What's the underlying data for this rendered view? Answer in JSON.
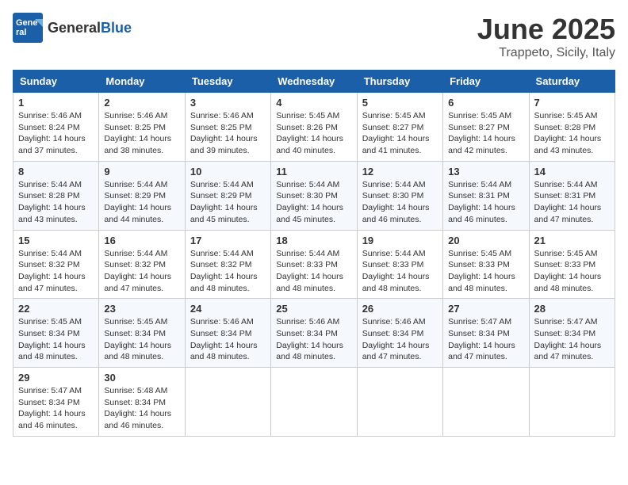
{
  "header": {
    "logo_general": "General",
    "logo_blue": "Blue",
    "month_title": "June 2025",
    "location": "Trappeto, Sicily, Italy"
  },
  "calendar": {
    "days_of_week": [
      "Sunday",
      "Monday",
      "Tuesday",
      "Wednesday",
      "Thursday",
      "Friday",
      "Saturday"
    ],
    "weeks": [
      [
        {
          "day": "",
          "content": ""
        },
        {
          "day": "2",
          "content": "Sunrise: 5:46 AM\nSunset: 8:25 PM\nDaylight: 14 hours\nand 38 minutes."
        },
        {
          "day": "3",
          "content": "Sunrise: 5:46 AM\nSunset: 8:25 PM\nDaylight: 14 hours\nand 39 minutes."
        },
        {
          "day": "4",
          "content": "Sunrise: 5:45 AM\nSunset: 8:26 PM\nDaylight: 14 hours\nand 40 minutes."
        },
        {
          "day": "5",
          "content": "Sunrise: 5:45 AM\nSunset: 8:27 PM\nDaylight: 14 hours\nand 41 minutes."
        },
        {
          "day": "6",
          "content": "Sunrise: 5:45 AM\nSunset: 8:27 PM\nDaylight: 14 hours\nand 42 minutes."
        },
        {
          "day": "7",
          "content": "Sunrise: 5:45 AM\nSunset: 8:28 PM\nDaylight: 14 hours\nand 43 minutes."
        }
      ],
      [
        {
          "day": "1",
          "content": "Sunrise: 5:46 AM\nSunset: 8:24 PM\nDaylight: 14 hours\nand 37 minutes."
        },
        {
          "day": "9",
          "content": "Sunrise: 5:44 AM\nSunset: 8:29 PM\nDaylight: 14 hours\nand 44 minutes."
        },
        {
          "day": "10",
          "content": "Sunrise: 5:44 AM\nSunset: 8:29 PM\nDaylight: 14 hours\nand 45 minutes."
        },
        {
          "day": "11",
          "content": "Sunrise: 5:44 AM\nSunset: 8:30 PM\nDaylight: 14 hours\nand 45 minutes."
        },
        {
          "day": "12",
          "content": "Sunrise: 5:44 AM\nSunset: 8:30 PM\nDaylight: 14 hours\nand 46 minutes."
        },
        {
          "day": "13",
          "content": "Sunrise: 5:44 AM\nSunset: 8:31 PM\nDaylight: 14 hours\nand 46 minutes."
        },
        {
          "day": "14",
          "content": "Sunrise: 5:44 AM\nSunset: 8:31 PM\nDaylight: 14 hours\nand 47 minutes."
        }
      ],
      [
        {
          "day": "8",
          "content": "Sunrise: 5:44 AM\nSunset: 8:28 PM\nDaylight: 14 hours\nand 43 minutes."
        },
        {
          "day": "16",
          "content": "Sunrise: 5:44 AM\nSunset: 8:32 PM\nDaylight: 14 hours\nand 47 minutes."
        },
        {
          "day": "17",
          "content": "Sunrise: 5:44 AM\nSunset: 8:32 PM\nDaylight: 14 hours\nand 48 minutes."
        },
        {
          "day": "18",
          "content": "Sunrise: 5:44 AM\nSunset: 8:33 PM\nDaylight: 14 hours\nand 48 minutes."
        },
        {
          "day": "19",
          "content": "Sunrise: 5:44 AM\nSunset: 8:33 PM\nDaylight: 14 hours\nand 48 minutes."
        },
        {
          "day": "20",
          "content": "Sunrise: 5:45 AM\nSunset: 8:33 PM\nDaylight: 14 hours\nand 48 minutes."
        },
        {
          "day": "21",
          "content": "Sunrise: 5:45 AM\nSunset: 8:33 PM\nDaylight: 14 hours\nand 48 minutes."
        }
      ],
      [
        {
          "day": "15",
          "content": "Sunrise: 5:44 AM\nSunset: 8:32 PM\nDaylight: 14 hours\nand 47 minutes."
        },
        {
          "day": "23",
          "content": "Sunrise: 5:45 AM\nSunset: 8:34 PM\nDaylight: 14 hours\nand 48 minutes."
        },
        {
          "day": "24",
          "content": "Sunrise: 5:46 AM\nSunset: 8:34 PM\nDaylight: 14 hours\nand 48 minutes."
        },
        {
          "day": "25",
          "content": "Sunrise: 5:46 AM\nSunset: 8:34 PM\nDaylight: 14 hours\nand 48 minutes."
        },
        {
          "day": "26",
          "content": "Sunrise: 5:46 AM\nSunset: 8:34 PM\nDaylight: 14 hours\nand 47 minutes."
        },
        {
          "day": "27",
          "content": "Sunrise: 5:47 AM\nSunset: 8:34 PM\nDaylight: 14 hours\nand 47 minutes."
        },
        {
          "day": "28",
          "content": "Sunrise: 5:47 AM\nSunset: 8:34 PM\nDaylight: 14 hours\nand 47 minutes."
        }
      ],
      [
        {
          "day": "22",
          "content": "Sunrise: 5:45 AM\nSunset: 8:34 PM\nDaylight: 14 hours\nand 48 minutes."
        },
        {
          "day": "30",
          "content": "Sunrise: 5:48 AM\nSunset: 8:34 PM\nDaylight: 14 hours\nand 46 minutes."
        },
        {
          "day": "",
          "content": ""
        },
        {
          "day": "",
          "content": ""
        },
        {
          "day": "",
          "content": ""
        },
        {
          "day": "",
          "content": ""
        },
        {
          "day": "",
          "content": ""
        }
      ],
      [
        {
          "day": "29",
          "content": "Sunrise: 5:47 AM\nSunset: 8:34 PM\nDaylight: 14 hours\nand 46 minutes."
        },
        {
          "day": "",
          "content": ""
        },
        {
          "day": "",
          "content": ""
        },
        {
          "day": "",
          "content": ""
        },
        {
          "day": "",
          "content": ""
        },
        {
          "day": "",
          "content": ""
        },
        {
          "day": "",
          "content": ""
        }
      ]
    ]
  }
}
